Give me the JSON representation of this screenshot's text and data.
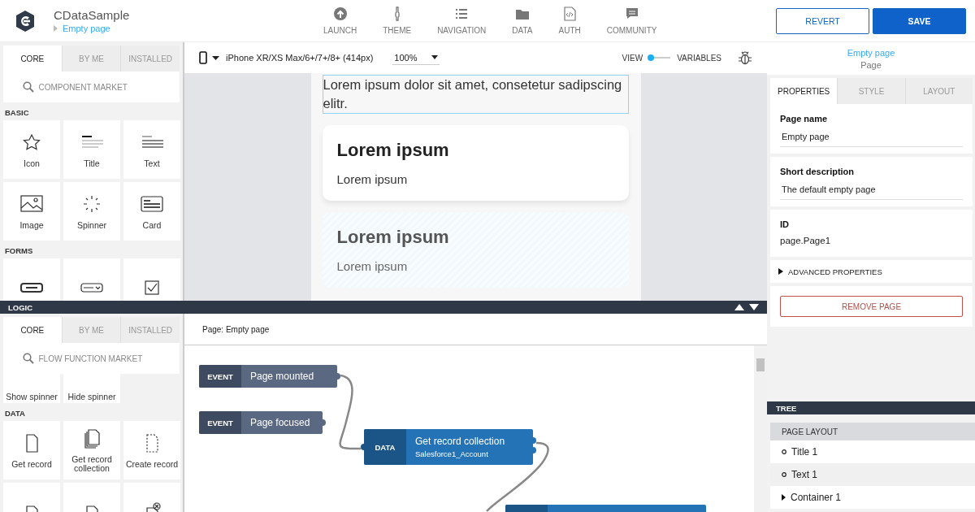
{
  "header": {
    "app_name": "CDataSample",
    "breadcrumb": "Empty page",
    "nav": [
      {
        "label": "LAUNCH"
      },
      {
        "label": "THEME"
      },
      {
        "label": "NAVIGATION"
      },
      {
        "label": "DATA"
      },
      {
        "label": "AUTH"
      },
      {
        "label": "COMMUNITY"
      }
    ],
    "buttons": [
      {
        "label": "REVERT",
        "kind": "secondary"
      },
      {
        "label": "SAVE",
        "kind": "primary"
      }
    ]
  },
  "component_panel": {
    "tabs": [
      {
        "label": "CORE",
        "selected": true
      },
      {
        "label": "BY ME",
        "selected": false
      },
      {
        "label": "INSTALLED",
        "selected": false
      }
    ],
    "search": {
      "placeholder": "COMPONENT MARKET"
    },
    "sections": [
      {
        "title": "BASIC",
        "items": [
          {
            "label": "Icon",
            "kind": "star"
          },
          {
            "label": "Title",
            "kind": "title"
          },
          {
            "label": "Text",
            "kind": "text"
          },
          {
            "label": "Image",
            "kind": "image"
          },
          {
            "label": "Spinner",
            "kind": "spinner"
          },
          {
            "label": "Card",
            "kind": "card"
          }
        ]
      },
      {
        "title": "FORMS",
        "items": [
          {
            "kind": "input"
          },
          {
            "kind": "select"
          },
          {
            "kind": "checkbox"
          }
        ]
      }
    ]
  },
  "toolbar": {
    "device": "iPhone XR/XS Max/6+/7+/8+ (414px)",
    "zoom": "100%",
    "toggle": {
      "left_label": "VIEW",
      "right_label": "VARIABLES",
      "on": false
    }
  },
  "preview": {
    "paragraph": "Lorem ipsum dolor sit amet, consetetur sadipscing elitr.",
    "cards": [
      {
        "title": "Lorem ipsum",
        "body": "Lorem ipsum",
        "highlighted": false
      },
      {
        "title": "Lorem ipsum",
        "body": "Lorem ipsum",
        "highlighted": true
      }
    ]
  },
  "logic": {
    "title": "LOGIC",
    "tabs": [
      {
        "label": "CORE",
        "selected": true
      },
      {
        "label": "BY ME",
        "selected": false
      },
      {
        "label": "INSTALLED",
        "selected": false
      }
    ],
    "search": {
      "placeholder": "FLOW FUNCTION MARKET"
    },
    "partial_items": [
      {
        "label": "Show spinner"
      },
      {
        "label": "Hide spinner"
      }
    ],
    "sections": [
      {
        "title": "DATA",
        "items": [
          {
            "label": "Get record",
            "kind": "doc"
          },
          {
            "label": "Get record collection",
            "kind": "docs"
          },
          {
            "label": "Create record",
            "kind": "dashed-doc"
          },
          {
            "kind": "doc-edit"
          },
          {
            "kind": "doc-edit"
          },
          {
            "kind": "doc-delete"
          }
        ]
      }
    ],
    "page_label": "Page: Empty page",
    "nodes": [
      {
        "kind": "event",
        "type": "EVENT",
        "title": "Page mounted"
      },
      {
        "kind": "event",
        "type": "EVENT",
        "title": "Page focused"
      },
      {
        "kind": "data",
        "type": "DATA",
        "title": "Get record collection",
        "subtitle": "Salesforce1_Account"
      },
      {
        "kind": "data"
      }
    ]
  },
  "inspector": {
    "selected_name": "Empty page",
    "selected_type": "Page",
    "tabs": [
      {
        "label": "PROPERTIES",
        "selected": true
      },
      {
        "label": "STYLE",
        "selected": false
      },
      {
        "label": "LAYOUT",
        "selected": false
      }
    ],
    "fields": [
      {
        "label": "Page name",
        "value": "Empty page",
        "kind": "input"
      },
      {
        "label": "Short description",
        "value": "The default empty page",
        "kind": "input"
      },
      {
        "label": "ID",
        "value": "page.Page1",
        "kind": "text"
      }
    ],
    "advanced": {
      "label": "ADVANCED PROPERTIES",
      "expanded": false
    },
    "remove_button": "REMOVE PAGE"
  },
  "tree": {
    "title": "TREE",
    "root": "PAGE LAYOUT",
    "items": [
      {
        "label": "Title 1",
        "kind": "leaf",
        "selected": false
      },
      {
        "label": "Text 1",
        "kind": "leaf",
        "selected": true
      },
      {
        "label": "Container 1",
        "kind": "branch",
        "selected": false
      }
    ]
  }
}
